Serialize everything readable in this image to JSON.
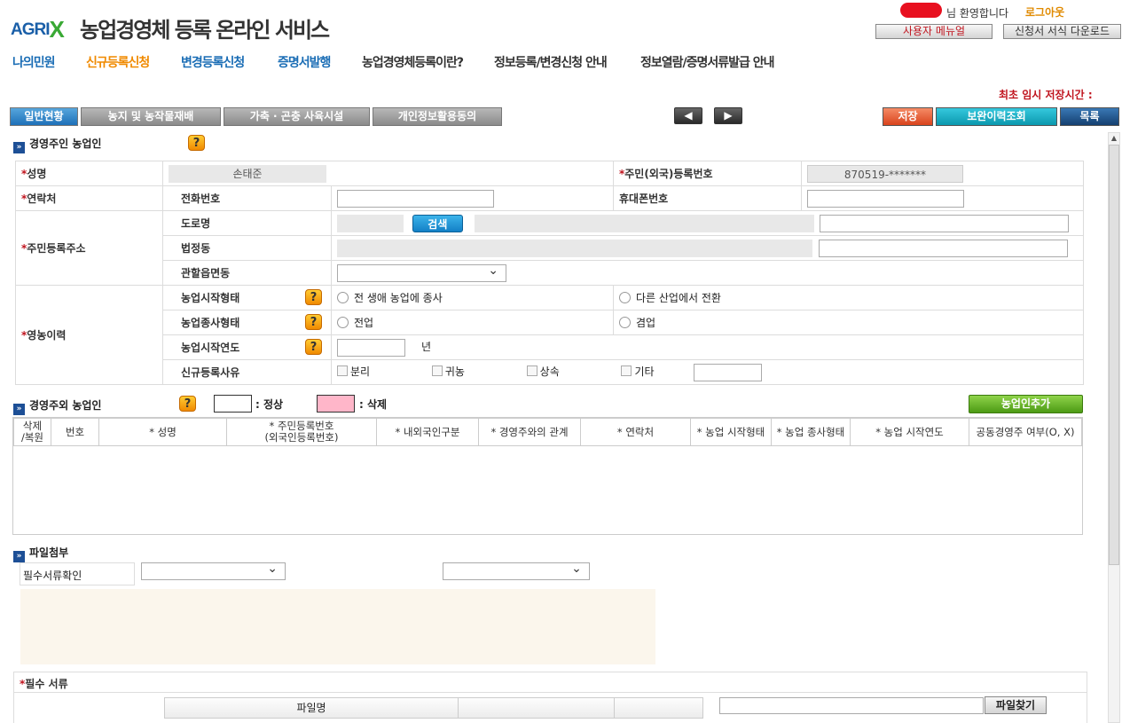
{
  "header": {
    "logo_text": "AGRI",
    "logo_x": "X",
    "title": "농업경영체 등록 온라인 서비스",
    "welcome": "님 환영합니다",
    "logout": "로그아웃",
    "manual": "사용자 메뉴얼",
    "download": "신청서 서식 다운로드"
  },
  "nav": [
    "나의민원",
    "신규등록신청",
    "변경등록신청",
    "증명서발행",
    "농업경영체등록이란?",
    "정보등록/변경신청 안내",
    "정보열람/증명서류발급 안내"
  ],
  "save_time_label": "최초 임시 저장시간 :",
  "tabs": [
    "일반현황",
    "농지 및 농작물재배",
    "가축 · 곤충 사육시설",
    "개인정보활용동의"
  ],
  "arrows": {
    "prev": "◀",
    "next": "▶"
  },
  "actions": {
    "save": "저장",
    "history": "보완이력조회",
    "list": "목록"
  },
  "section1": {
    "title": "경영주인 농업인",
    "name_label": "성명",
    "name_value": "손태준",
    "rrn_label": "주민(외국)등록번호",
    "rrn_value": "870519-*******",
    "contact_label": "연락처",
    "phone_label": "전화번호",
    "mobile_label": "휴대폰번호",
    "address_label": "주민등록주소",
    "road_label": "도로명",
    "search_btn": "검색",
    "legal_label": "법정동",
    "district_label": "관할읍면동",
    "career_label": "영농이력",
    "start_type_label": "농업시작형태",
    "start_type_opt1": "전 생애 농업에 종사",
    "start_type_opt2": "다른 산업에서 전환",
    "work_type_label": "농업종사형태",
    "work_type_opt1": "전업",
    "work_type_opt2": "겸업",
    "start_year_label": "농업시작연도",
    "year_unit": "년",
    "reason_label": "신규등록사유",
    "reason_opts": [
      "분리",
      "귀농",
      "상속",
      "기타"
    ]
  },
  "section2": {
    "title": "경영주외 농업인",
    "normal_label": ": 정상",
    "deleted_label": ": 삭제",
    "add_btn": "농업인추가",
    "headers": [
      "삭제\n/복원",
      "번호",
      "* 성명",
      "* 주민등록번호\n(외국인등록번호)",
      "* 내외국인구분",
      "* 경영주와의 관계",
      "* 연락처",
      "* 농업 시작형태",
      "* 농업 종사형태",
      "* 농업 시작연도",
      "공동경영주 여부(O, X)"
    ]
  },
  "section3": {
    "title": "파일첨부",
    "doc_check_label": "필수서류확인",
    "required_docs_label": "필수 서류",
    "file_col": "파일명",
    "find_file_btn": "파일찾기"
  },
  "colors": {
    "required": "#c0141e",
    "nav_blue": "#1a6db5",
    "nav_orange": "#f08a00",
    "deleted_swatch": "#ffb6c9"
  }
}
